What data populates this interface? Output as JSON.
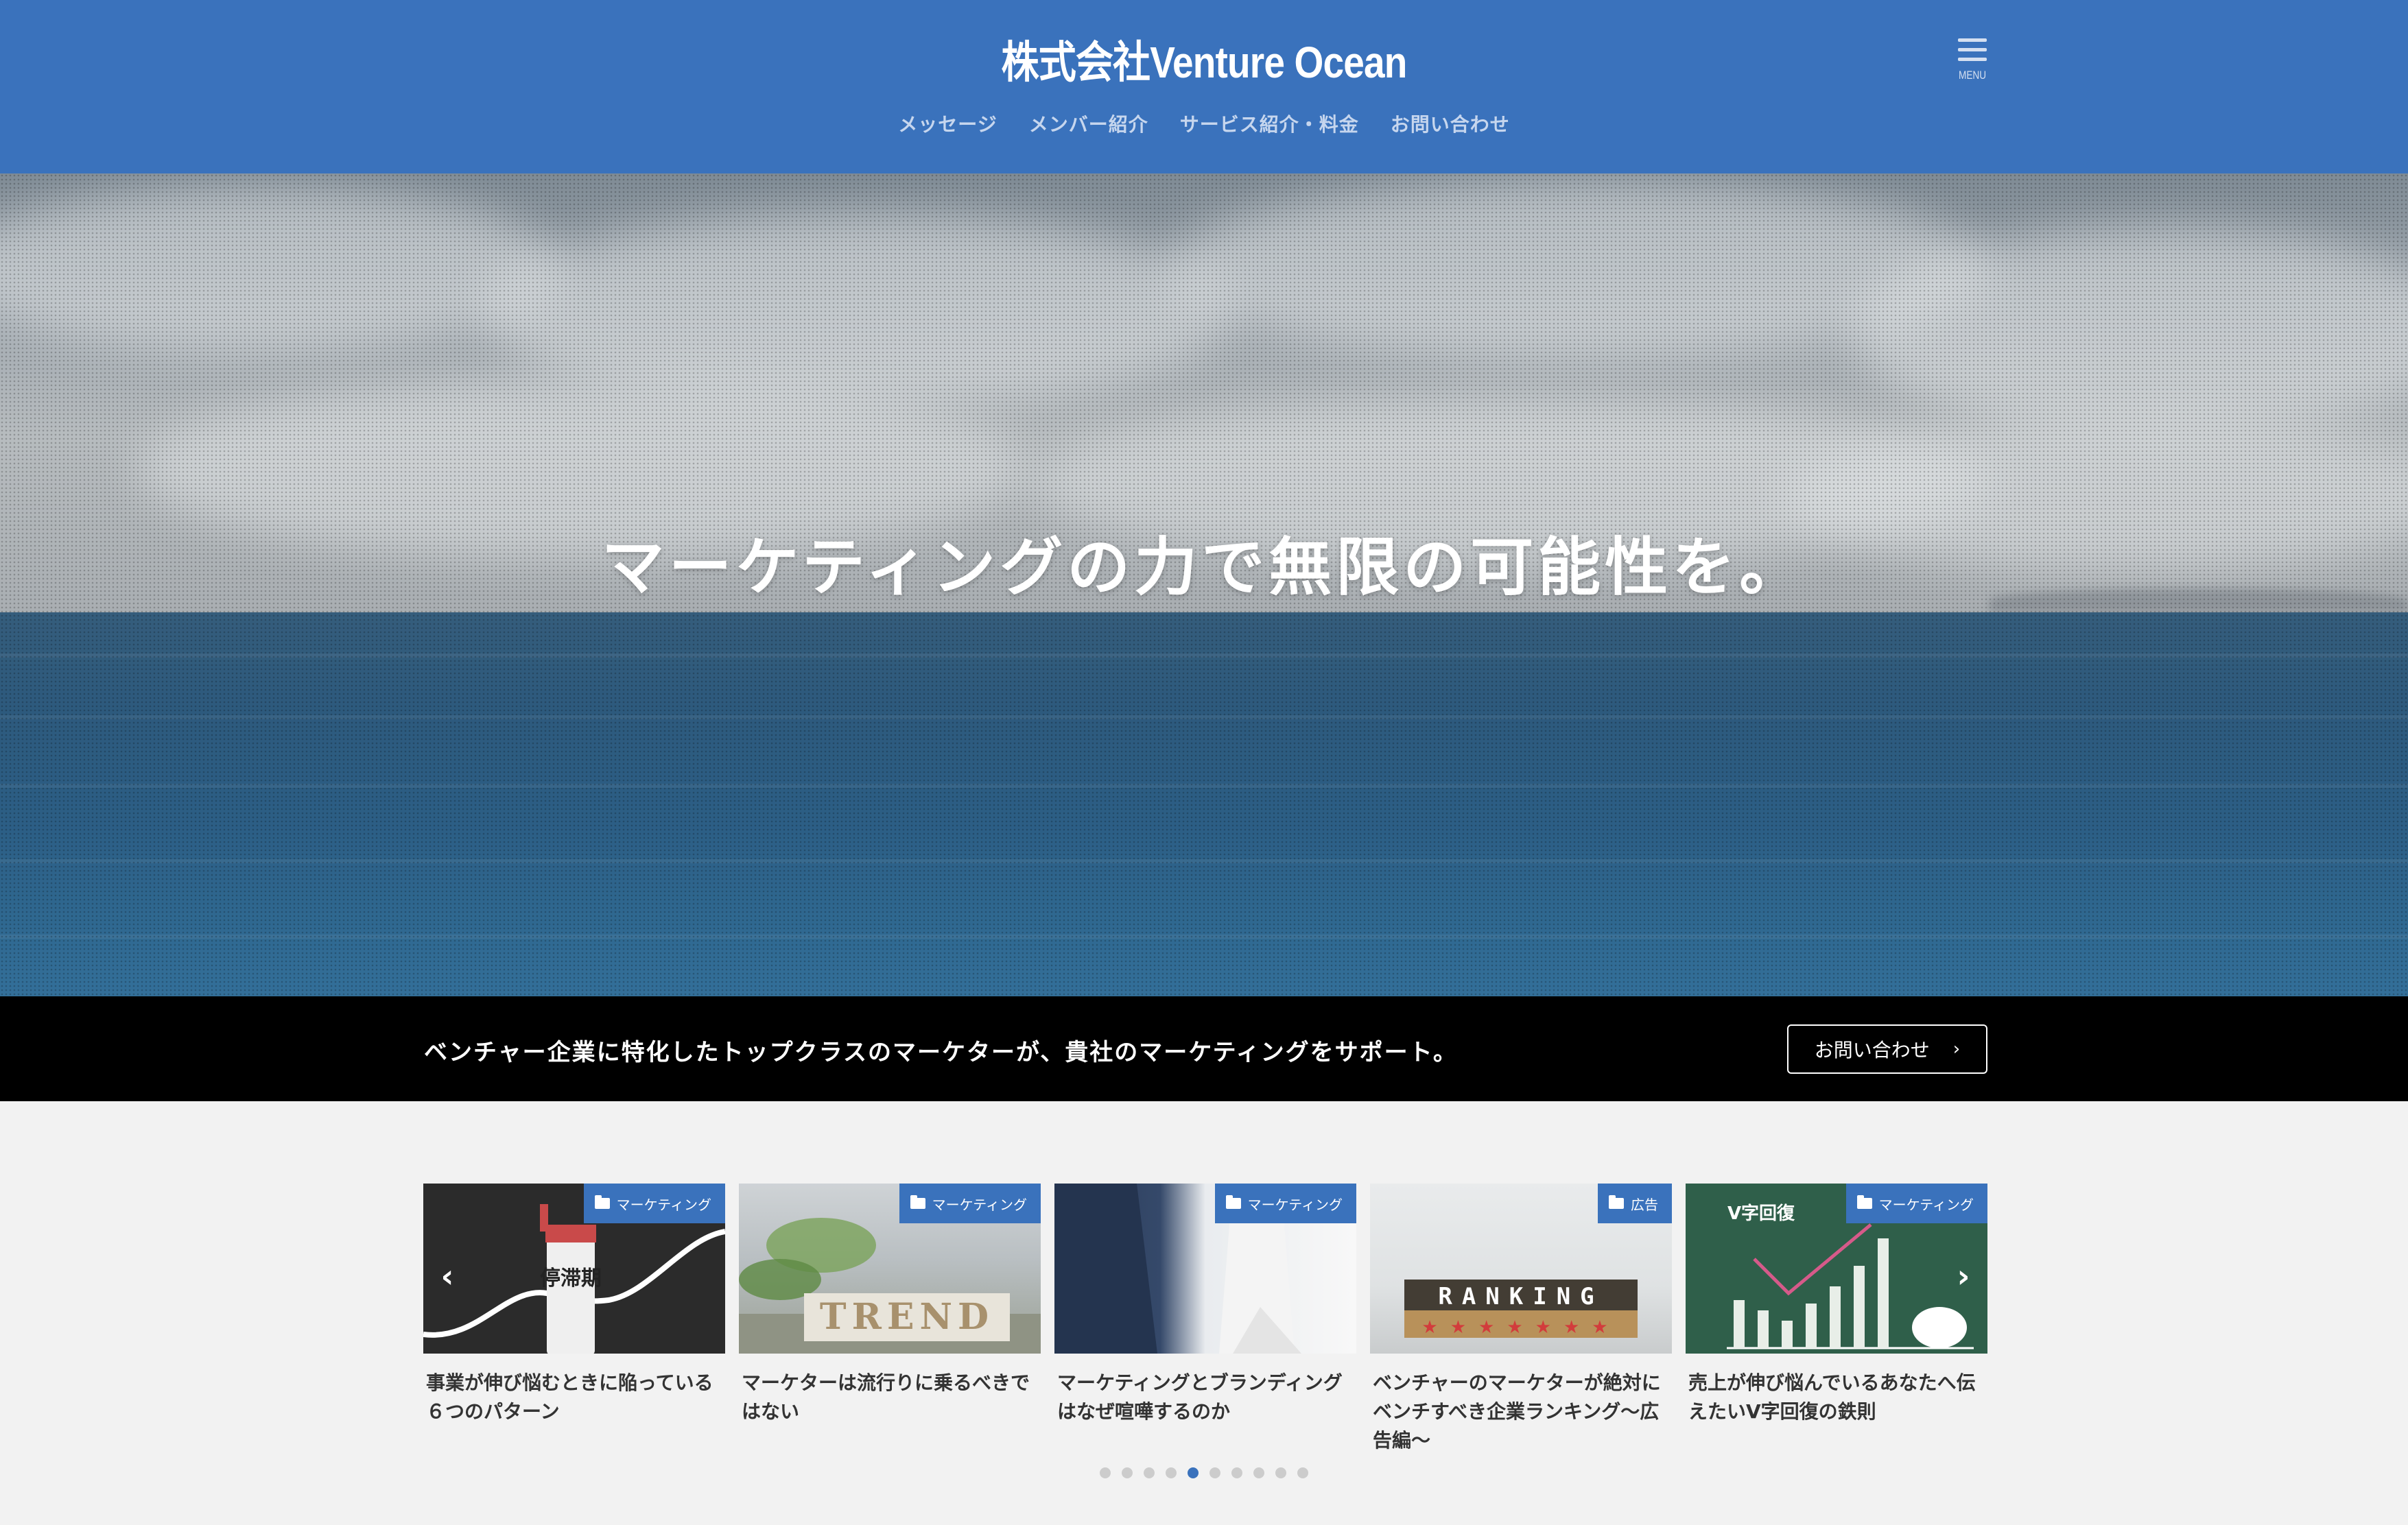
{
  "header": {
    "site_title": "株式会社Venture Ocean",
    "nav": [
      "メッセージ",
      "メンバー紹介",
      "サービス紹介・料金",
      "お問い合わせ"
    ],
    "menu_label": "MENU"
  },
  "hero": {
    "headline": "マーケティングの力で無限の可能性を。"
  },
  "cta_bar": {
    "text": "ベンチャー企業に特化したトップクラスのマーケターが、貴社のマーケティングをサポート。",
    "button_label": "お問い合わせ",
    "button_icon": "chevron-right-icon"
  },
  "slider": {
    "cards": [
      {
        "category": "マーケティング",
        "title": "事業が伸び悩むときに陥っている６つのパターン",
        "image_text": "停滞期"
      },
      {
        "category": "マーケティング",
        "title": "マーケターは流行りに乗るべきではない",
        "image_text": "TREND"
      },
      {
        "category": "マーケティング",
        "title": "マーケティングとブランディングはなぜ喧嘩するのか",
        "image_text": ""
      },
      {
        "category": "広告",
        "title": "ベンチャーのマーケターが絶対にベンチすべき企業ランキング〜広告編〜",
        "image_text": "RANKING"
      },
      {
        "category": "マーケティング",
        "title": "売上が伸び悩んでいるあなたへ伝えたいV字回復の鉄則",
        "image_text": "V字回復"
      }
    ],
    "pager": {
      "count": 10,
      "active_index": 4
    },
    "prev_icon": "chevron-left-icon",
    "next_icon": "chevron-right-icon"
  },
  "colors": {
    "header_bg": "#3a72bc",
    "cta_bg": "#000000",
    "page_bg": "#f2f2f2",
    "badge_bg": "#3a72bc"
  }
}
